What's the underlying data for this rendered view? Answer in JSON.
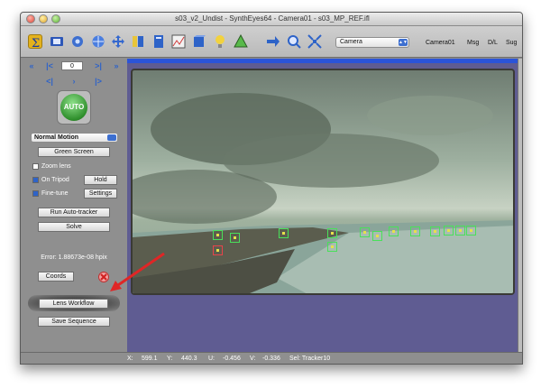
{
  "window": {
    "title": "s03_v2_Undist - SynthEyes64 - Camera01 - s03_MP_REF.ifl"
  },
  "toolbar": {
    "icons": [
      "sigma-icon",
      "camera-view-icon",
      "gear-icon",
      "sphere-icon",
      "move-icon",
      "panel-icon",
      "document-icon",
      "graph-icon",
      "box-icon",
      "light-icon",
      "mesh-icon",
      "arrow-right-icon",
      "zoom-icon",
      "fit-icon"
    ],
    "camera_select": "Camera",
    "camera_label": "Camera01",
    "msg_label": "Msg",
    "dl_label": "D/L",
    "sug_label": "Sug"
  },
  "left": {
    "frame_value": "0",
    "auto_label": "AUTO",
    "motion_select": "Normal Motion",
    "green_screen": "Green Screen",
    "zoom_lens": "Zoom lens",
    "on_tripod": "On Tripod",
    "hold": "Hold",
    "fine_tune": "Fine-tune",
    "settings": "Settings",
    "run_auto_tracker": "Run Auto-tracker",
    "solve": "Solve",
    "error": "Error: 1.88673e-08 hpix",
    "coords": "Coords",
    "lens_workflow": "Lens Workflow",
    "save_sequence": "Save Sequence"
  },
  "status": {
    "x_label": "X:",
    "x_value": "599.1",
    "y_label": "Y:",
    "y_value": "440.3",
    "u_label": "U:",
    "u_value": "-0.456",
    "v_label": "V:",
    "v_value": "-0.336",
    "sel_label": "Sel: Tracker10"
  },
  "colors": {
    "accent": "#2e63c8",
    "tracker_ok": "#49e05a",
    "tracker_bad": "#e8434a",
    "annotation": "#e02626"
  }
}
